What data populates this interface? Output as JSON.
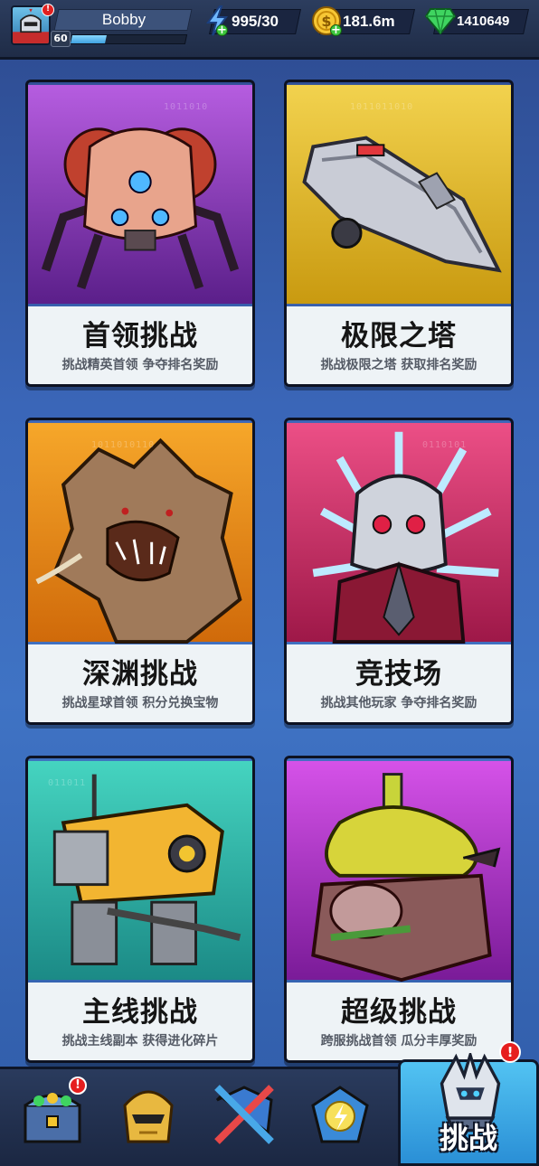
{
  "player": {
    "name": "Bobby",
    "level": "60",
    "xp_fraction": 0.3,
    "alert": "!"
  },
  "resources": {
    "energy": "995/30",
    "gold": "181.6m",
    "gems": "1410649"
  },
  "cards": [
    {
      "title": "首领挑战",
      "subtitle": "挑战精英首领 争夺排名奖励",
      "theme_color": "#8b3fc4",
      "art": "spider-mech-boss"
    },
    {
      "title": "极限之塔",
      "subtitle": "挑战极限之塔 获取排名奖励",
      "theme_color": "#e3b81e",
      "art": "drill-ship"
    },
    {
      "title": "深渊挑战",
      "subtitle": "挑战星球首领 积分兑换宝物",
      "theme_color": "#ee8a16",
      "art": "abyss-monster"
    },
    {
      "title": "竞技场",
      "subtitle": "挑战其他玩家 争夺排名奖励",
      "theme_color": "#d02f66",
      "art": "spiked-robot"
    },
    {
      "title": "主线挑战",
      "subtitle": "挑战主线副本 获得进化碎片",
      "theme_color": "#2fb3a4",
      "art": "yellow-mech"
    },
    {
      "title": "超级挑战",
      "subtitle": "跨服挑战首领 瓜分丰厚奖励",
      "theme_color": "#b23cc8",
      "art": "serpent-beast"
    }
  ],
  "bottom_nav": [
    {
      "icon": "treasure-chest-icon",
      "alert": "!"
    },
    {
      "icon": "golden-helmet-icon",
      "alert": ""
    },
    {
      "icon": "crossed-swords-icon",
      "alert": ""
    },
    {
      "icon": "lightning-shield-icon",
      "alert": ""
    },
    {
      "icon": "challenge-helmet-icon",
      "label": "挑战",
      "alert": "!",
      "active": true
    }
  ]
}
